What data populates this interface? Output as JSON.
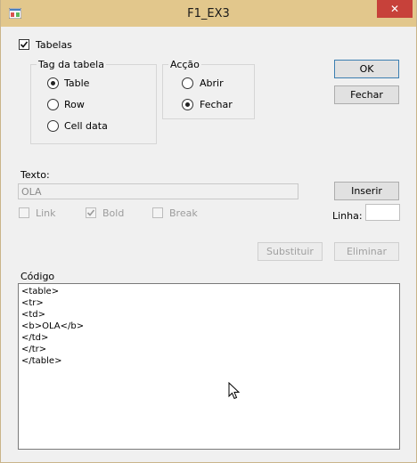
{
  "window": {
    "title": "F1_EX3",
    "close_glyph": "✕"
  },
  "tabelas": {
    "label": "Tabelas",
    "checked": true
  },
  "tag_group": {
    "label": "Tag da tabela",
    "options": [
      {
        "label": "Table",
        "selected": true
      },
      {
        "label": "Row",
        "selected": false
      },
      {
        "label": "Cell data",
        "selected": false
      }
    ]
  },
  "accao_group": {
    "label": "Acção",
    "options": [
      {
        "label": "Abrir",
        "selected": false
      },
      {
        "label": "Fechar",
        "selected": true
      }
    ]
  },
  "buttons": {
    "ok": "OK",
    "fechar": "Fechar",
    "inserir": "Inserir",
    "substituir": "Substituir",
    "eliminar": "Eliminar"
  },
  "texto": {
    "label": "Texto:",
    "value": "OLA"
  },
  "format_options": [
    {
      "label": "Link",
      "checked": false
    },
    {
      "label": "Bold",
      "checked": true
    },
    {
      "label": "Break",
      "checked": false
    }
  ],
  "linha": {
    "label": "Linha:",
    "value": ""
  },
  "codigo": {
    "label": "Código",
    "lines": [
      "<table>",
      "<tr>",
      "<td>",
      "<b>OLA</b>",
      "</td>",
      "</tr>",
      "</table>"
    ]
  },
  "icons": {
    "app": "app-icon",
    "close": "close-icon",
    "cursor": "mouse-cursor-icon"
  },
  "colors": {
    "titlebar": "#e2c78c",
    "close": "#c7413a",
    "window": "#f0f0f0"
  }
}
